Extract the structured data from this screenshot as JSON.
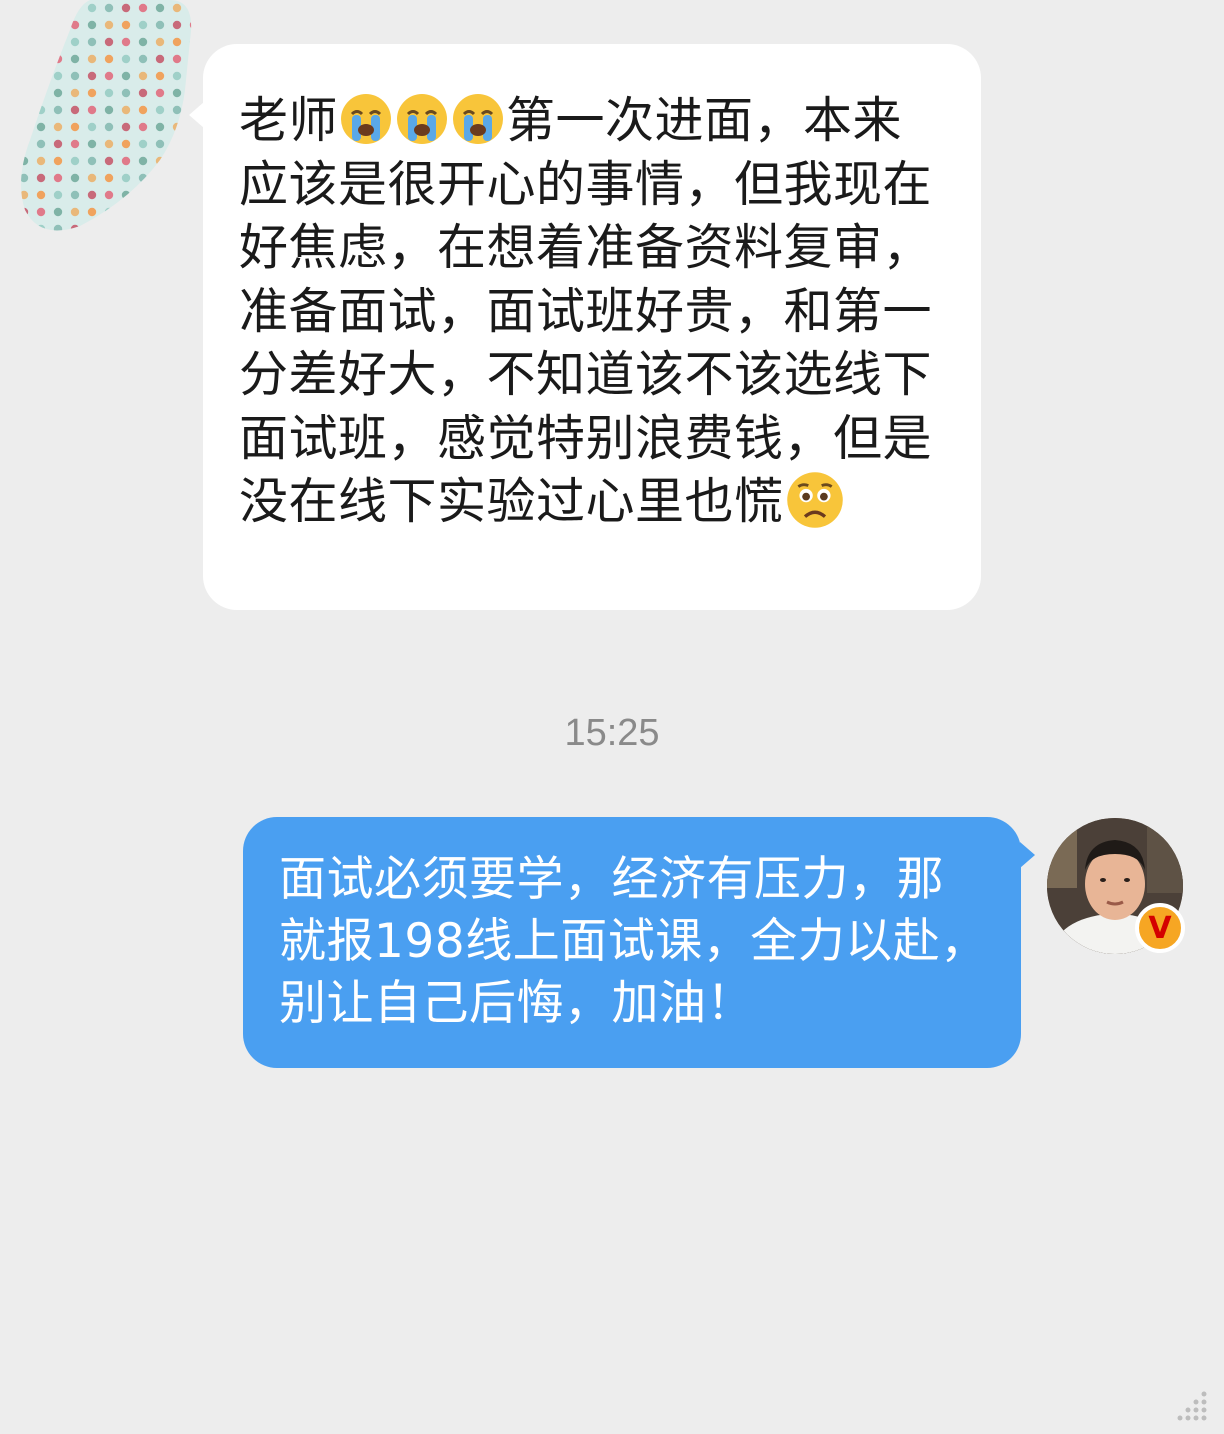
{
  "messages": {
    "incoming": {
      "text_part1": "老师",
      "text_part2": "第一次进面，本来应该是很开心的事情，但我现在好焦虑，在想着准备资料复审，准备面试，面试班好贵，和第一分差好大，不知道该不该选线下面试班，感觉特别浪费钱，但是没在线下实验过心里也慌",
      "emoji_crying": "loudly-crying-face-emoji",
      "emoji_worried": "worried-face-emoji"
    },
    "timestamp": "15:25",
    "outgoing": {
      "text": "面试必须要学，经济有压力，那就报198线上面试课，全力以赴，别让自己后悔，加油！",
      "badge_label": "V",
      "badge_icon": "verified-badge-icon"
    }
  },
  "colors": {
    "background": "#ededed",
    "incoming_bubble": "#ffffff",
    "outgoing_bubble": "#4a9ff1",
    "timestamp": "#8a8a8a",
    "badge": "#f6a623"
  }
}
